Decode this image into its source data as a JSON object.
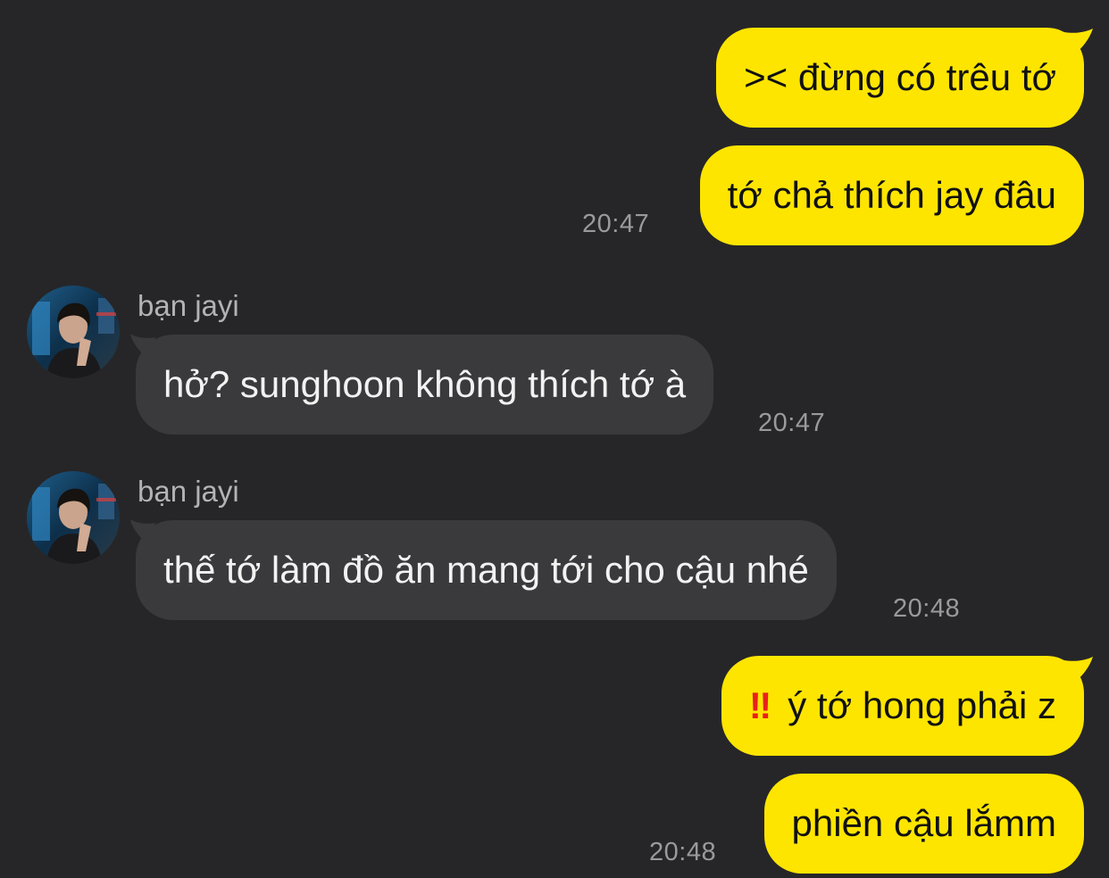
{
  "colors": {
    "background": "#262628",
    "sent_bubble": "#fee500",
    "received_bubble": "#3a3a3c",
    "timestamp": "#9a9a9c",
    "alert": "#e8201a"
  },
  "messages": [
    {
      "direction": "sent",
      "text": ">< đừng có trêu tớ"
    },
    {
      "direction": "sent",
      "text": "tớ chả thích jay đâu",
      "time": "20:47"
    },
    {
      "direction": "received",
      "sender": "bạn jayi",
      "avatar_icon": "contact-avatar",
      "text": "hở? sunghoon không thích tớ à",
      "time": "20:47"
    },
    {
      "direction": "received",
      "sender": "bạn jayi",
      "avatar_icon": "contact-avatar",
      "text": "thế tớ làm đồ ăn mang tới cho cậu nhé",
      "time": "20:48"
    },
    {
      "direction": "sent",
      "emoji": "‼",
      "emoji_icon": "double-exclamation-icon",
      "text": "ý tớ hong phải z"
    },
    {
      "direction": "sent",
      "text": "phiền cậu lắmm",
      "time": "20:48"
    }
  ]
}
